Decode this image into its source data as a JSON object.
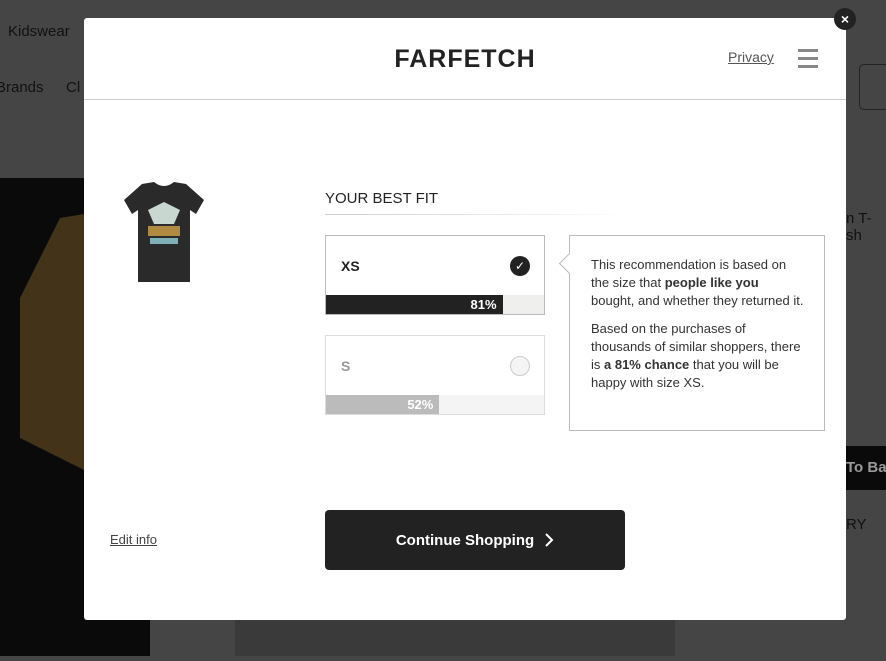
{
  "background": {
    "nav_kidswear": "Kidswear",
    "nav_brands": "Brands",
    "nav_clothing": "Cl",
    "product_title_fragment": "n T-sh",
    "add_to_bag_fragment": "To Ba",
    "text_fragment": "RY"
  },
  "modal": {
    "logo": "FARFETCH",
    "privacy": "Privacy",
    "close": "×",
    "fit_title": "YOUR BEST FIT",
    "sizes": [
      {
        "label": "XS",
        "percent_label": "81%",
        "percent": 81,
        "selected": true
      },
      {
        "label": "S",
        "percent_label": "52%",
        "percent": 52,
        "selected": false
      }
    ],
    "tooltip": {
      "p1_a": "This recommendation is based on the size that ",
      "p1_b": "people like you",
      "p1_c": " bought, and whether they returned it.",
      "p2_a": "Based on the purchases of thousands of similar shoppers, there is ",
      "p2_b": "a 81% chance",
      "p2_c": " that you will be happy with size XS."
    },
    "edit_info": "Edit info",
    "continue": "Continue Shopping"
  },
  "colors": {
    "primary": "#222222",
    "muted_bar": "#bbbbbb",
    "overlay": "rgba(0,0,0,0.74)"
  }
}
